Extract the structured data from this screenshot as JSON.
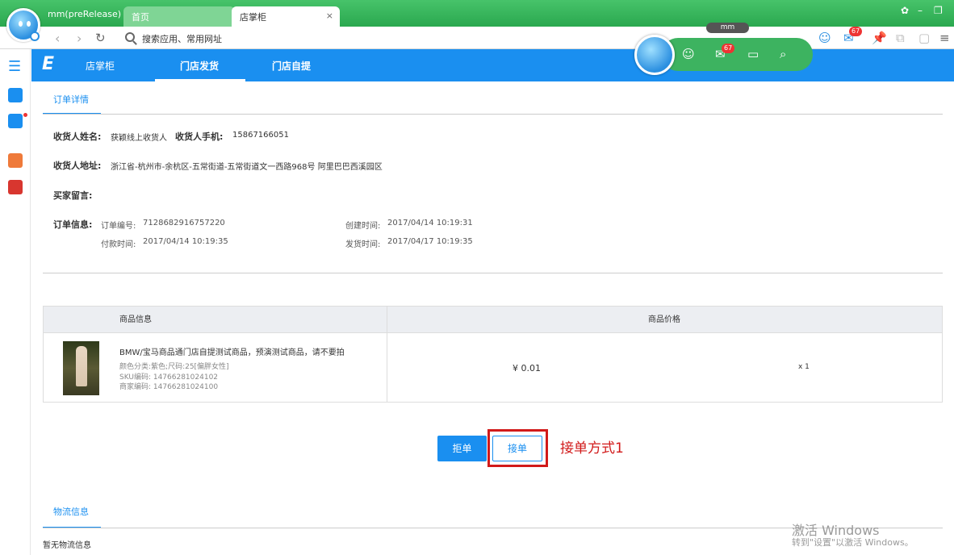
{
  "browser": {
    "user_label": "mm(preRelease)",
    "tabs": [
      {
        "label": "首页"
      },
      {
        "label": "店掌柜"
      }
    ],
    "close_glyph": "×",
    "address_placeholder": "搜索应用、常用网址",
    "mail_badge": "67"
  },
  "widget": {
    "name": "mm",
    "mail_badge": "67"
  },
  "app": {
    "logo_text": "店掌柜",
    "tabs": [
      {
        "label": "门店发货",
        "active": true
      },
      {
        "label": "门店自提",
        "active": false
      }
    ]
  },
  "order": {
    "section_title": "订单详情",
    "receiver_name_label": "收货人姓名:",
    "receiver_name": "获颖线上收货人",
    "receiver_phone_label": "收货人手机:",
    "receiver_phone": "15867166051",
    "address_label": "收货人地址:",
    "address": "浙江省-杭州市-余杭区-五常街道-五常街道文一西路968号 阿里巴巴西溪园区",
    "message_label": "买家留言:",
    "info_label": "订单信息:",
    "order_no_label": "订单编号:",
    "order_no": "7128682916757220",
    "created_label": "创建时间:",
    "created": "2017/04/14 10:19:31",
    "paid_label": "付款时间:",
    "paid": "2017/04/14 10:19:35",
    "shipped_label": "发货时间:",
    "shipped": "2017/04/17 10:19:35"
  },
  "goods": {
    "header_info": "商品信息",
    "header_price": "商品价格",
    "rows": [
      {
        "title": "BMW/宝马商品通门店自提测试商品，预演测试商品，请不要拍",
        "attr_color": "颜色分类:紫色;尺码:25[偏胖女性]",
        "sku": "SKU编码: 14766281024102",
        "merchant_code": "商家编码: 14766281024100",
        "price": "¥ 0.01",
        "qty": "x 1"
      }
    ]
  },
  "actions": {
    "reject": "拒单",
    "accept": "接单",
    "annotation": "接单方式1"
  },
  "logistics": {
    "section_title": "物流信息",
    "empty_text": "暂无物流信息"
  },
  "watermark": {
    "line1": "激活 Windows",
    "line2": "转到\"设置\"以激活 Windows。"
  },
  "colors": {
    "accent": "#1a8ff0",
    "browser_green": "#2aa84f",
    "highlight_red": "#d11a1a"
  }
}
